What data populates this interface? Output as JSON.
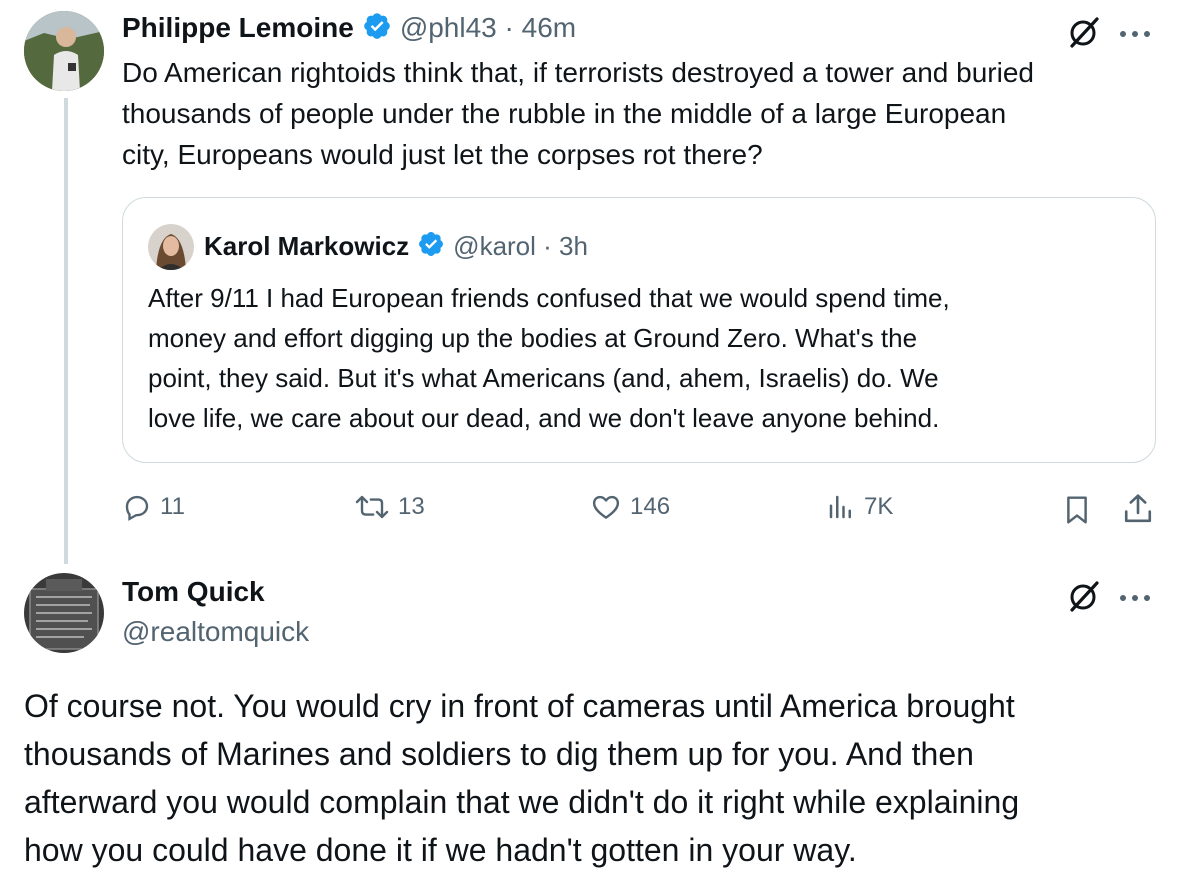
{
  "tweet": {
    "author_name": "Philippe Lemoine",
    "handle_time": "@phl43 · 46m",
    "text_lines": [
      "Do American rightoids think that, if terrorists destroyed a tower and buried",
      "thousands of people under the rubble in the middle of a large European",
      "city, Europeans would just let the corpses rot there?"
    ],
    "quote": {
      "author_name": "Karol Markowicz",
      "handle_time": "@karol · 3h",
      "text_lines": [
        "After 9/11 I had European friends confused that we would spend time,",
        "money and effort digging up the bodies at Ground Zero. What's the",
        "point, they said. But it's what Americans (and, ahem, Israelis) do. We",
        "love life, we care about our dead, and we don't leave anyone behind."
      ]
    },
    "actions": {
      "replies": "11",
      "reposts": "13",
      "likes": "146",
      "views": "7K"
    }
  },
  "reply": {
    "author_name": "Tom Quick",
    "handle": "@realtomquick",
    "text_lines": [
      "Of course not. You would cry in front of cameras until America brought",
      "thousands of Marines and soldiers to dig them up for you. And then",
      "afterward you would complain that we didn't do it right while explaining",
      "how you could have done it if we hadn't gotten in your way."
    ]
  },
  "colors": {
    "verified": "#1d9bf0",
    "secondary_text": "#536471",
    "border": "#cfd9de"
  }
}
